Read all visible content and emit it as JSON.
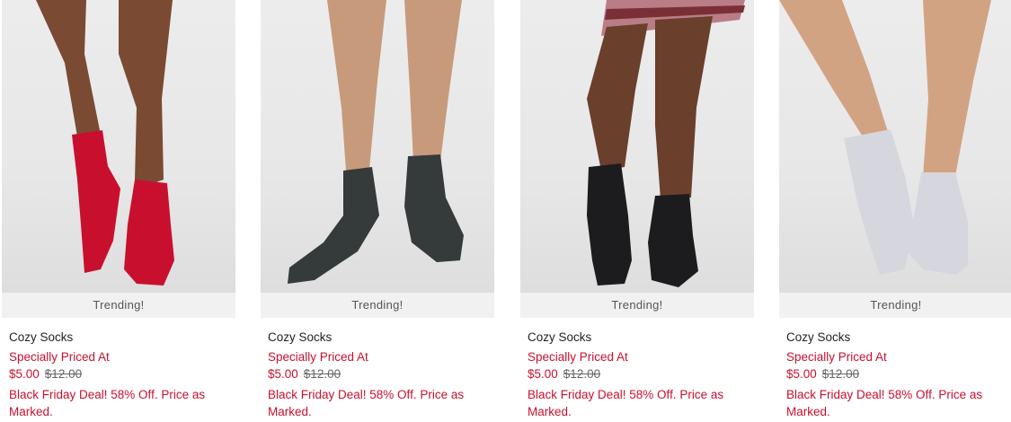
{
  "products": [
    {
      "badge": "Trending!",
      "name": "Cozy Socks",
      "promo": "Specially Priced At",
      "sale_price": "$5.00",
      "original_price": "$12.00",
      "deal_text": "Black Friday Deal! 58% Off. Price as Marked.",
      "sock_color": "#c8102e",
      "skin_color": "#7a4a33"
    },
    {
      "badge": "Trending!",
      "name": "Cozy Socks",
      "promo": "Specially Priced At",
      "sale_price": "$5.00",
      "original_price": "$12.00",
      "deal_text": "Black Friday Deal! 58% Off. Price as Marked.",
      "sock_color": "#353a3b",
      "skin_color": "#c79a7c"
    },
    {
      "badge": "Trending!",
      "name": "Cozy Socks",
      "promo": "Specially Priced At",
      "sale_price": "$5.00",
      "original_price": "$12.00",
      "deal_text": "Black Friday Deal! 58% Off. Price as Marked.",
      "sock_color": "#1c1c1e",
      "skin_color": "#6a3f2b"
    },
    {
      "badge": "Trending!",
      "name": "Cozy Socks",
      "promo": "Specially Priced At",
      "sale_price": "$5.00",
      "original_price": "$12.00",
      "deal_text": "Black Friday Deal! 58% Off. Price as Marked.",
      "sock_color": "#d6d6de",
      "skin_color": "#d2a383"
    }
  ]
}
